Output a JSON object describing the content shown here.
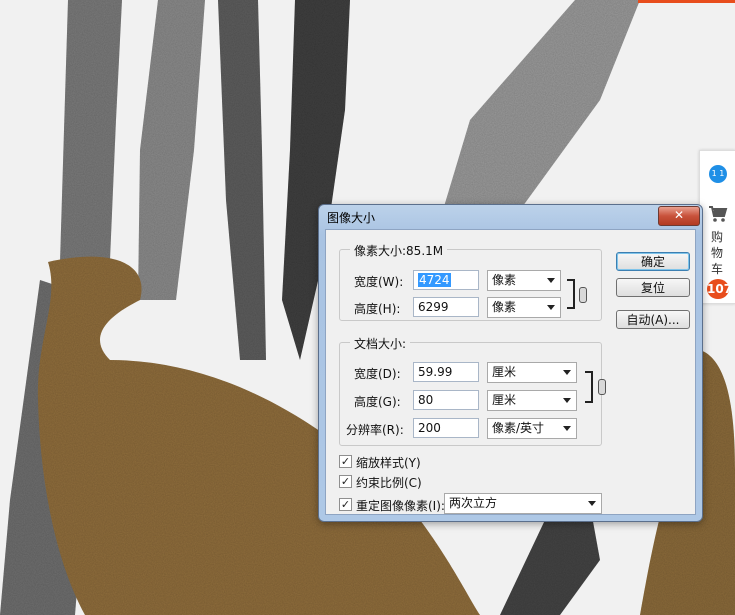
{
  "dialog": {
    "title": "图像大小",
    "close_label": "✕",
    "pixel_dims": {
      "label": "像素大小:85.1M",
      "width_label": "宽度(W):",
      "width_value_selected": "4724",
      "width_unit": "像素",
      "height_label": "高度(H):",
      "height_value": "6299",
      "height_unit": "像素"
    },
    "doc_size": {
      "label": "文档大小:",
      "width_label": "宽度(D):",
      "width_value": "59.99",
      "width_unit": "厘米",
      "height_label": "高度(G):",
      "height_value": "80",
      "height_unit": "厘米",
      "resolution_label": "分辨率(R):",
      "resolution_value": "200",
      "resolution_unit": "像素/英寸"
    },
    "options": {
      "scale_styles": {
        "label": "缩放样式(Y)",
        "checked": true
      },
      "constrain": {
        "label": "约束比例(C)",
        "checked": true
      },
      "resample": {
        "label": "重定图像像素(I):",
        "checked": true
      },
      "resample_method": "两次立方"
    },
    "buttons": {
      "ok": "确定",
      "reset": "复位",
      "auto": "自动(A)..."
    }
  },
  "side_widget": {
    "cart_label": "购物车",
    "cart_count": "107",
    "badge_text": "1 1"
  },
  "colors": {
    "accent": "#e84d1c",
    "leaf_brown": "#8f6d3c",
    "stroke_gray": "#6f6f6f"
  }
}
